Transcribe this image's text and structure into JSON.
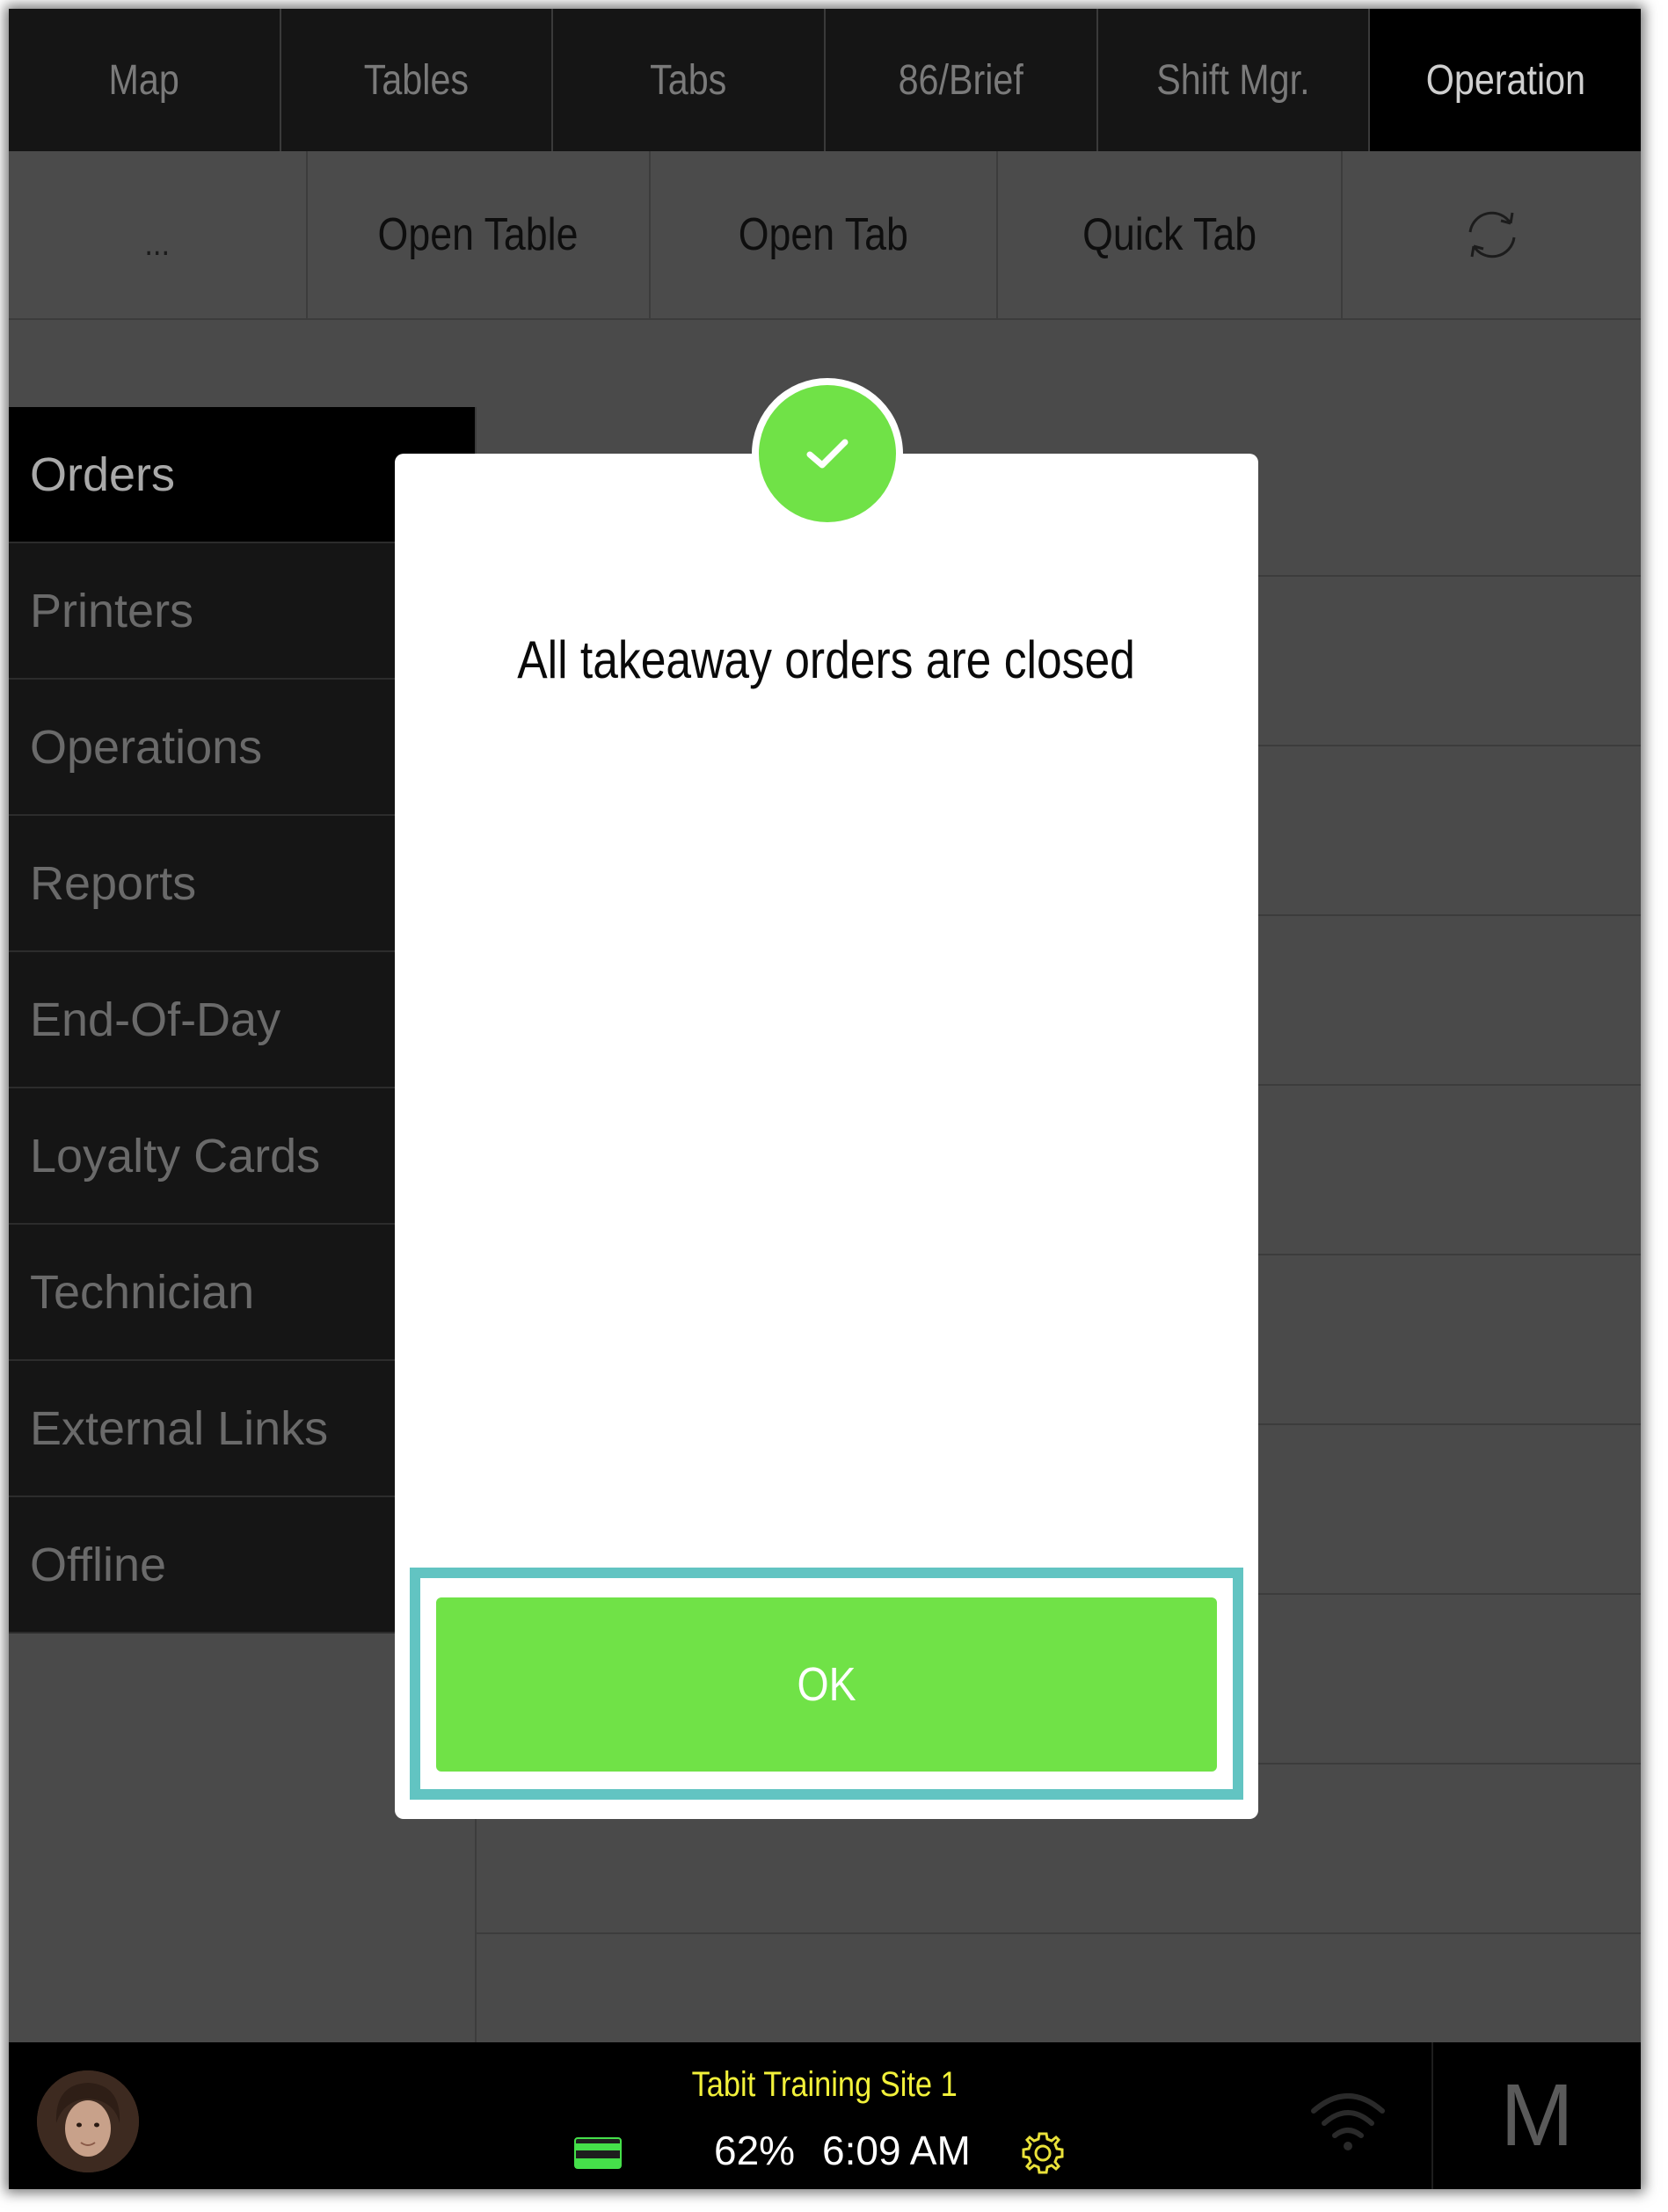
{
  "top_nav": {
    "tabs": [
      {
        "label": "Map",
        "active": false
      },
      {
        "label": "Tables",
        "active": false
      },
      {
        "label": "Tabs",
        "active": false
      },
      {
        "label": "86/Brief",
        "active": false
      },
      {
        "label": "Shift Mgr.",
        "active": false
      },
      {
        "label": "Operation",
        "active": true
      }
    ]
  },
  "action_bar": {
    "more_label": "...",
    "open_table_label": "Open Table",
    "open_tab_label": "Open Tab",
    "quick_tab_label": "Quick Tab",
    "refresh_icon": "refresh-icon"
  },
  "sidebar": {
    "items": [
      {
        "label": "Orders",
        "active": true
      },
      {
        "label": "Printers",
        "active": false
      },
      {
        "label": "Operations",
        "active": false
      },
      {
        "label": "Reports",
        "active": false
      },
      {
        "label": "End-Of-Day",
        "active": false
      },
      {
        "label": "Loyalty Cards",
        "active": false
      },
      {
        "label": "Technician",
        "active": false
      },
      {
        "label": "External Links",
        "active": false
      },
      {
        "label": "Offline",
        "active": false
      }
    ]
  },
  "dialog": {
    "icon": "checkmark-icon",
    "message": "All takeaway orders are closed",
    "ok_label": "OK"
  },
  "status_bar": {
    "site_name": "Tabit Training Site 1",
    "battery": "62%",
    "time": "6:09 AM",
    "user_initial": "M",
    "icons": [
      "avatar",
      "card-icon",
      "settings-icon",
      "wifi-icon"
    ]
  },
  "colors": {
    "accent_green": "#70e247",
    "highlight_teal": "#62c4c2",
    "site_name_yellow": "#f2f13a"
  }
}
